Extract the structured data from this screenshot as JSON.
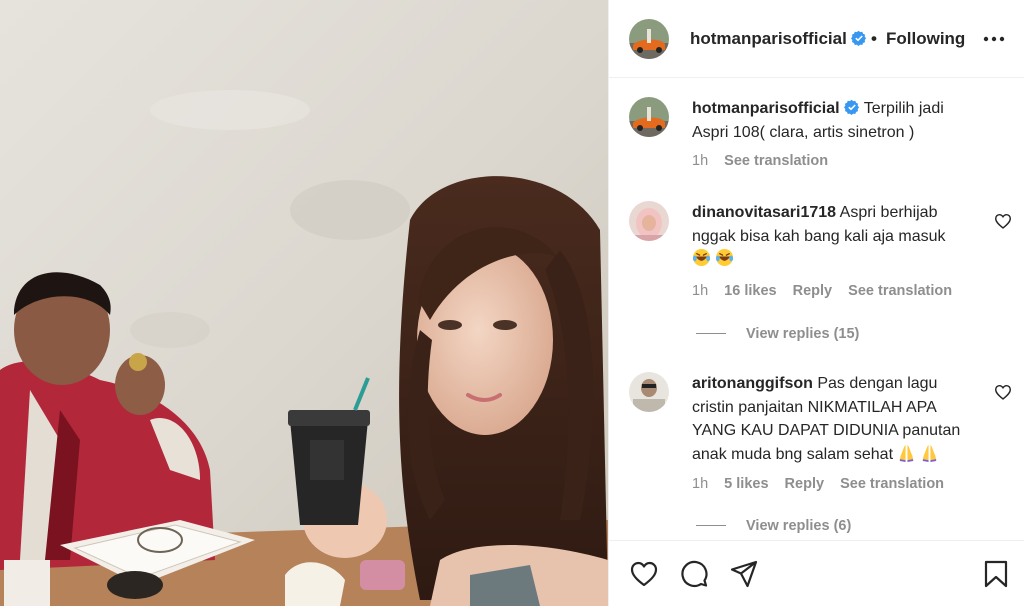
{
  "post": {
    "username": "hotmanparisofficial",
    "follow_separator": "•",
    "follow_status": "Following",
    "caption": "Terpilih jadi Aspri 108( clara, artis sinetron )",
    "caption_time": "1h",
    "caption_translation": "See translation"
  },
  "comments": [
    {
      "username": "dinanovitasari1718",
      "text": "Aspri berhijab nggak bisa kah bang kali aja masuk",
      "emojis": [
        "laughing-emoji",
        "laughing-emoji"
      ],
      "time": "1h",
      "likes": "16 likes",
      "reply": "Reply",
      "translation": "See translation",
      "view_replies": "View replies (15)"
    },
    {
      "username": "aritonanggifson",
      "text": "Pas dengan lagu cristin panjaitan NIKMATILAH APA YANG KAU DAPAT DIDUNIA panutan anak muda bng salam sehat",
      "emojis": [
        "praying-hands-emoji",
        "praying-hands-emoji"
      ],
      "time": "1h",
      "likes": "5 likes",
      "reply": "Reply",
      "translation": "See translation",
      "view_replies": "View replies (6)"
    }
  ],
  "icons": {
    "verified": "verified-badge-icon",
    "more": "more-options-icon",
    "like": "heart-icon",
    "comment": "comment-icon",
    "share": "share-icon",
    "save": "bookmark-icon"
  },
  "colors": {
    "text": "#262626",
    "secondary": "#8e8e8e",
    "verified": "#3897f0",
    "border": "#efefef"
  }
}
